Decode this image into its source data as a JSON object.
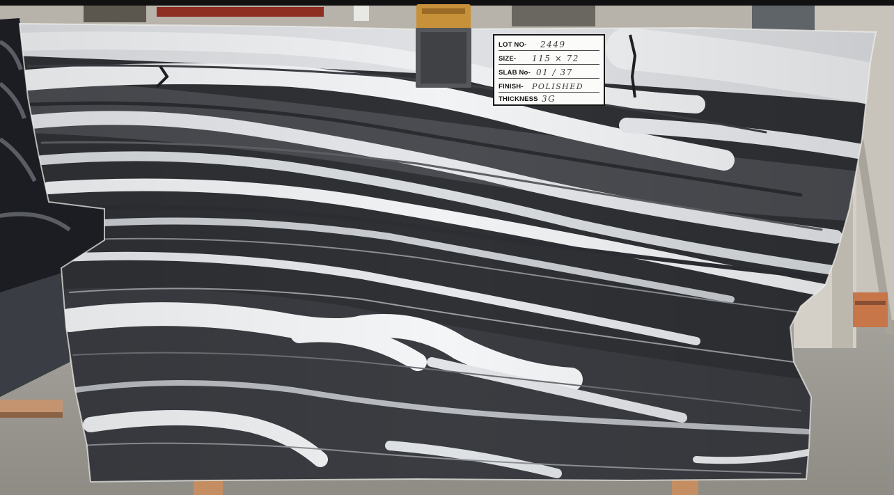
{
  "photo": {
    "subject": "polished marble slab",
    "colors": {
      "floor": "#9d9a94",
      "wall": "#b9b4ab",
      "stone_dark": "#303236",
      "stone_mid": "#55575c",
      "vein_white": "#e9ebee",
      "pallet_wood": "#c09068",
      "clip": "#c7913a"
    }
  },
  "slab_tag": {
    "rows": [
      {
        "label": "LOT NO-",
        "value": "2449"
      },
      {
        "label": "SIZE-",
        "value": "115 × 72"
      },
      {
        "label": "SLAB No-",
        "value": "01 / 37"
      },
      {
        "label": "FINISH-",
        "value": "POLISHED"
      },
      {
        "label": "THICKNESS",
        "value": "3G"
      }
    ]
  }
}
